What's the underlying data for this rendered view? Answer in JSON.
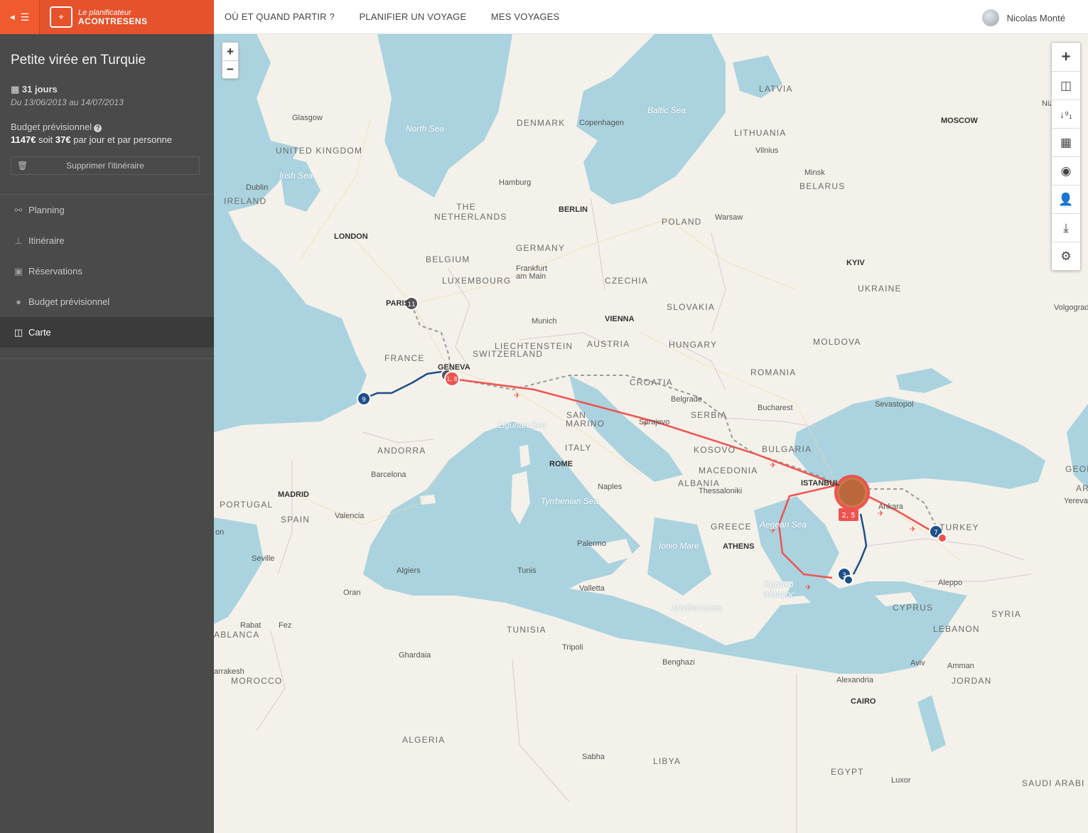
{
  "brand": {
    "line1": "Le planificateur",
    "line2": "ACONTRESENS"
  },
  "sidebar": {
    "trip_title": "Petite virée en Turquie",
    "duration": "31 jours",
    "dates": "Du 13/06/2013 au 14/07/2013",
    "budget_label": "Budget prévisionnel",
    "budget_total": "1147€",
    "budget_mid": "soit",
    "budget_daily": "37€",
    "budget_suffix": "par jour et par personne",
    "delete_label": "Supprimer l'itinéraire",
    "nav": [
      {
        "label": "Planning",
        "icon": "sitemap-icon"
      },
      {
        "label": "Itinéraire",
        "icon": "signpost-icon"
      },
      {
        "label": "Réservations",
        "icon": "suitcase-icon"
      },
      {
        "label": "Budget prévisionnel",
        "icon": "piggy-bank-icon"
      },
      {
        "label": "Carte",
        "icon": "map-icon",
        "active": true
      }
    ]
  },
  "topnav": {
    "items": [
      "OÙ ET QUAND PARTIR ?",
      "PLANIFIER UN VOYAGE",
      "MES VOYAGES"
    ],
    "user_name": "Nicolas Monté"
  },
  "map": {
    "zoom_in": "+",
    "zoom_out": "−",
    "markers": {
      "paris": "11",
      "lyon": "1, 8",
      "bordeaux": "9",
      "istanbul": "2, 5",
      "bodrum": "3",
      "kayseri": "7"
    },
    "labels": {
      "latvia": "LATVIA",
      "moscow": "MOSCOW",
      "nizhny": "Nizhny N",
      "denmark": "DENMARK",
      "copenhagen": "Copenhagen",
      "baltic": "Baltic Sea",
      "north_sea": "North Sea",
      "lithuania": "LITHUANIA",
      "vilnius": "Vilnius",
      "glasgow": "Glasgow",
      "uk": "UNITED KINGDOM",
      "minsk": "Minsk",
      "belarus": "BELARUS",
      "dublin": "Dublin",
      "irish_sea": "Irish Sea",
      "ireland": "IRELAND",
      "hamburg": "Hamburg",
      "netherlands": "THE NETHERLANDS",
      "berlin": "BERLIN",
      "warsaw": "Warsaw",
      "poland": "POLAND",
      "london": "LONDON",
      "germany": "GERMANY",
      "belgium": "BELGIUM",
      "kyiv": "KYIV",
      "frankfurt": "Frankfurt am Main",
      "luxembourg": "LUXEMBOURG",
      "czechia": "CZECHIA",
      "ukraine": "UKRAINE",
      "volgograd": "Volgograd",
      "paris": "PARIS",
      "slovakia": "SLOVAKIA",
      "munich": "Munich",
      "vienna": "VIENNA",
      "liechtenstein": "LIECHTENSTEIN",
      "austria": "AUSTRIA",
      "hungary": "HUNGARY",
      "moldova": "MOLDOVA",
      "switzerland": "SWITZERLAND",
      "france": "FRANCE",
      "geneva": "GENEVA",
      "romania": "ROMANIA",
      "croatia": "CROATIA",
      "belgrade": "Belgrade",
      "bucharest": "Bucharest",
      "sevastopol": "Sevastopol",
      "serbia": "SERBIA",
      "san_marino": "SAN MARINO",
      "ligurian": "Ligurian Sea",
      "sarajevo": "Sarajevo",
      "andorra": "ANDORRA",
      "italy": "ITALY",
      "kosovo": "KOSOVO",
      "bulgaria": "BULGARIA",
      "rome": "ROME",
      "barcelona": "Barcelona",
      "macedonia": "MACEDONIA",
      "georgia": "GEOR",
      "albania": "ALBANIA",
      "istanbul": "ISTANBUL",
      "madrid": "MADRID",
      "naples": "Naples",
      "thessaloniki": "Thessaloniki",
      "armenia": "AR",
      "portugal": "PORTUGAL",
      "tyrrhenian": "Tyrrhenian Sea",
      "ankara": "Ankara",
      "yerevan": "Yerevan",
      "spain": "SPAIN",
      "valencia": "Valencia",
      "greece": "GREECE",
      "aegean": "Aegean Sea",
      "turkey": "TURKEY",
      "lisbon": "on",
      "athens": "ATHENS",
      "palermo": "Palermo",
      "ionian": "Ionio Mare",
      "seville": "Seville",
      "algiers": "Algiers",
      "tunis": "Tunis",
      "cretan": "Κρητικό πέλαγος",
      "aleppo": "Aleppo",
      "oran": "Oran",
      "valletta": "Valletta",
      "cyprus": "CYPRUS",
      "mediterraneo": "Mediterraneo",
      "syria": "SYRIA",
      "rabat": "Rabat",
      "fez": "Fez",
      "casablanca": "ABLANCA",
      "tunisia": "TUNISIA",
      "lebanon": "LEBANON",
      "tripoli": "Tripoli",
      "ghardaia": "Ghardaia",
      "benghazi": "Benghazi",
      "aviv": "Aviv",
      "amman": "Amman",
      "marrakesh": "arrakesh",
      "morocco": "MOROCCO",
      "alexandria": "Alexandria",
      "jordan": "JORDAN",
      "cairo": "CAIRO",
      "algeria": "ALGERIA",
      "sabha": "Sabha",
      "libya": "LIBYA",
      "egypt": "EGYPT",
      "luxor": "Luxor",
      "saudi": "SAUDI ARABI"
    }
  },
  "colors": {
    "brand": "#e5522b",
    "sidebar": "#4a4a4a",
    "route_air": "#ef5350",
    "route_ground": "#1e4f8a",
    "route_planned": "#9a9a9a",
    "water": "#aad3df",
    "land": "#f4f1ea"
  }
}
